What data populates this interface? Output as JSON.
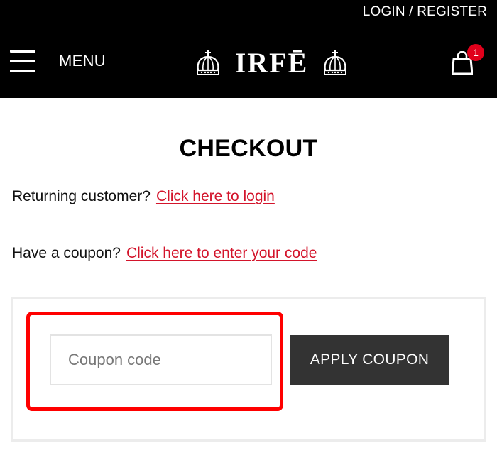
{
  "header": {
    "login_label": "LOGIN / REGISTER",
    "menu_label": "MENU",
    "logo_text": "IRFĒ",
    "cart_count": "1"
  },
  "page": {
    "title": "CHECKOUT"
  },
  "notices": {
    "login_prompt": "Returning customer?",
    "login_link": "Click here to login",
    "coupon_prompt": "Have a coupon?",
    "coupon_link": "Click here to enter your code"
  },
  "coupon_form": {
    "input_placeholder": "Coupon code",
    "input_value": "",
    "apply_label": "APPLY COUPON"
  },
  "colors": {
    "header_bg": "#000000",
    "link": "#d3142b",
    "badge": "#e0001b",
    "highlight": "#ff0000",
    "button_bg": "#333333"
  },
  "icons": [
    "hamburger-icon",
    "crown-icon",
    "shopping-bag-icon"
  ]
}
